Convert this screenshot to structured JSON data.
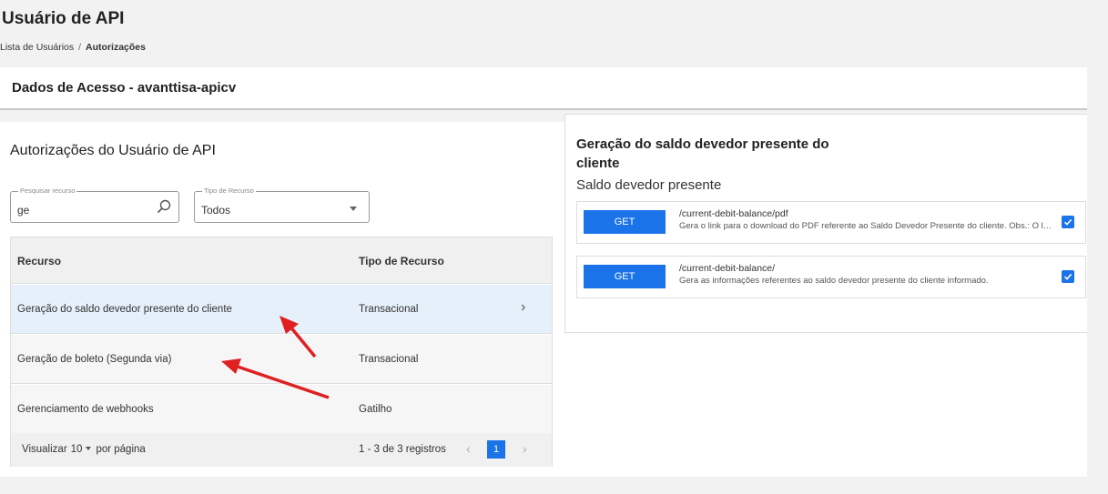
{
  "page": {
    "title": "Usuário de API",
    "breadcrumb": {
      "parent": "Lista de Usuários",
      "separator": "/",
      "current": "Autorizações"
    }
  },
  "access": {
    "title": "Dados de Acesso - avanttisa-apicv"
  },
  "authorizations": {
    "title": "Autorizações do Usuário de API",
    "search": {
      "label": "Pesquisar recurso",
      "value": "ge",
      "icon": "search-icon"
    },
    "type_filter": {
      "label": "Tipo de Recurso",
      "value": "Todos"
    },
    "table": {
      "headers": {
        "resource": "Recurso",
        "type": "Tipo de Recurso"
      },
      "rows": [
        {
          "resource": "Geração do saldo devedor presente do cliente",
          "type": "Transacional",
          "chevron": "›"
        },
        {
          "resource": "Geração de boleto (Segunda via)",
          "type": "Transacional"
        },
        {
          "resource": "Gerenciamento de webhooks",
          "type": "Gatilho"
        }
      ],
      "footer": {
        "per_page_label": "Visualizar",
        "per_page_value": "10",
        "per_page_suffix": "por página",
        "records": "1 - 3 de 3 registros",
        "prev": "‹",
        "current_page": "1",
        "next": "›"
      }
    }
  },
  "detail": {
    "title": "Geração do saldo devedor presente do cliente",
    "subtitle": "Saldo devedor presente",
    "endpoints": [
      {
        "method": "GET",
        "path": "/current-debit-balance/pdf",
        "description": "Gera o link para o download do PDF referente ao Saldo Devedor Presente do cliente. Obs.: O link expira após o primeiro download.",
        "checked": true
      },
      {
        "method": "GET",
        "path": "/current-debit-balance/",
        "description": "Gera as informações referentes ao saldo devedor presente do cliente informado.",
        "checked": true
      }
    ]
  },
  "colors": {
    "primary": "#1a73e8",
    "selected_row": "#e6f0fa",
    "annotation_arrow": "#e02020"
  }
}
